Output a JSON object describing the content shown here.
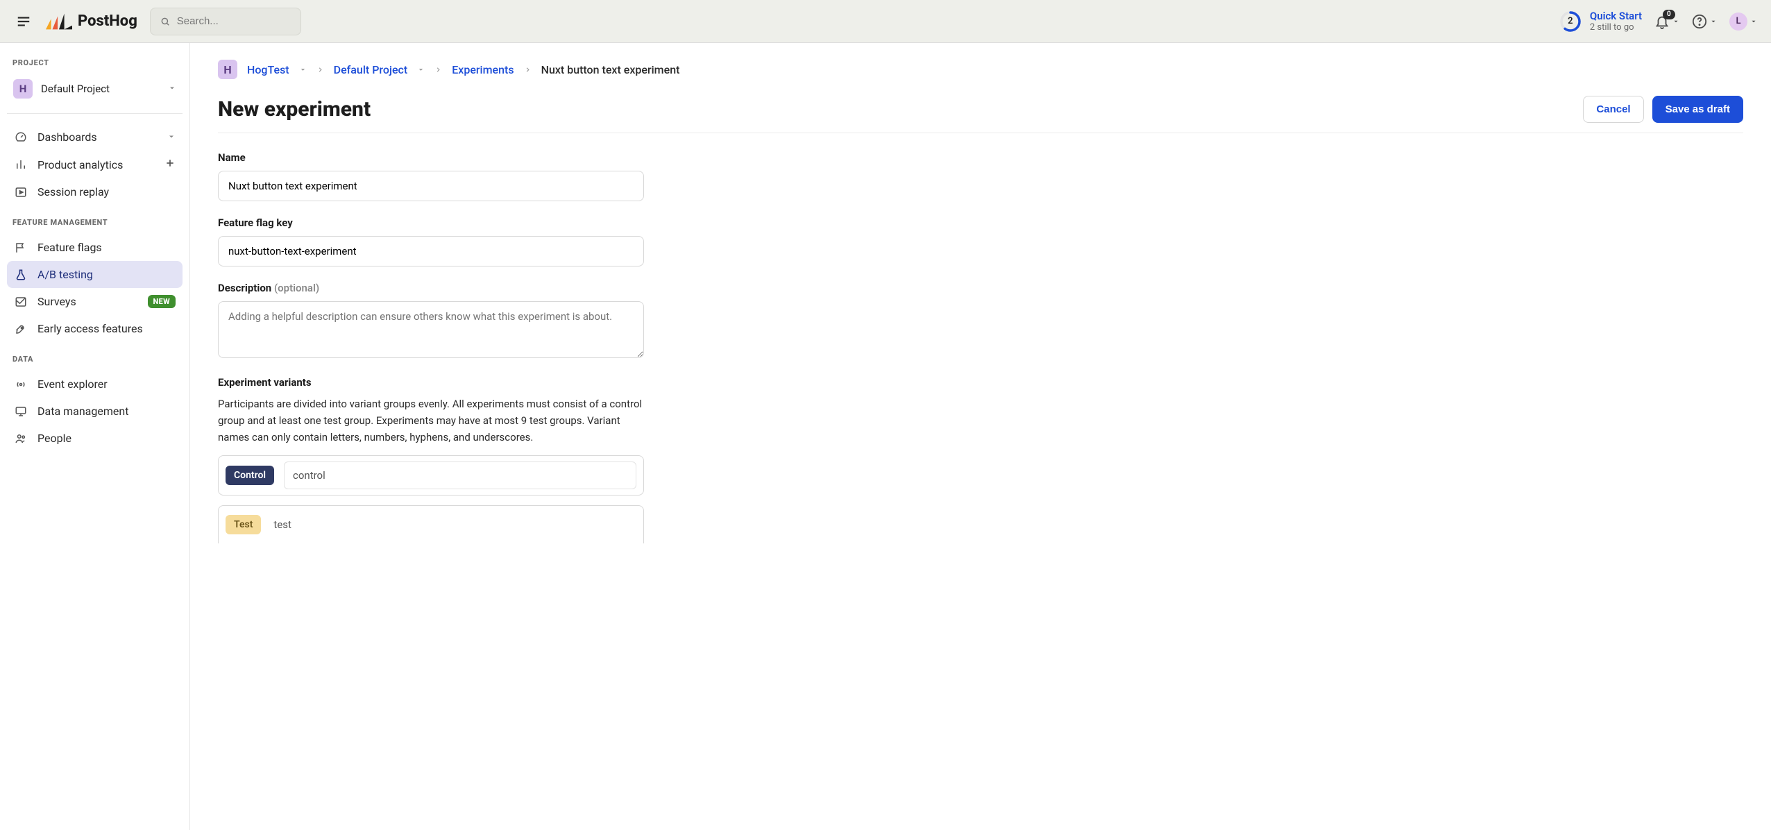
{
  "topbar": {
    "search_placeholder": "Search...",
    "quick_start": {
      "title": "Quick Start",
      "subtitle": "2 still to go",
      "count": "2"
    },
    "notif_count": "0",
    "avatar_letter": "L",
    "brand": "PostHog"
  },
  "sidebar": {
    "project_heading": "PROJECT",
    "project_badge": "H",
    "project_name": "Default Project",
    "items": {
      "dashboards": "Dashboards",
      "product_analytics": "Product analytics",
      "session_replay": "Session replay"
    },
    "feature_heading": "FEATURE MANAGEMENT",
    "feature_items": {
      "feature_flags": "Feature flags",
      "ab_testing": "A/B testing",
      "surveys": "Surveys",
      "surveys_badge": "NEW",
      "early_access": "Early access features"
    },
    "data_heading": "DATA",
    "data_items": {
      "event_explorer": "Event explorer",
      "data_management": "Data management",
      "people": "People"
    }
  },
  "breadcrumb": {
    "badge": "H",
    "org": "HogTest",
    "project": "Default Project",
    "section": "Experiments",
    "current": "Nuxt button text experiment"
  },
  "page": {
    "title": "New experiment",
    "cancel": "Cancel",
    "save": "Save as draft"
  },
  "form": {
    "name_label": "Name",
    "name_value": "Nuxt button text experiment",
    "flag_label": "Feature flag key",
    "flag_value": "nuxt-button-text-experiment",
    "desc_label": "Description",
    "desc_optional": "(optional)",
    "desc_placeholder": "Adding a helpful description can ensure others know what this experiment is about.",
    "variants_label": "Experiment variants",
    "variants_desc": "Participants are divided into variant groups evenly. All experiments must consist of a control group and at least one test group. Experiments may have at most 9 test groups. Variant names can only contain letters, numbers, hyphens, and underscores.",
    "variant_control_chip": "Control",
    "variant_control_value": "control",
    "variant_test_chip": "Test",
    "variant_test_value": "test"
  }
}
